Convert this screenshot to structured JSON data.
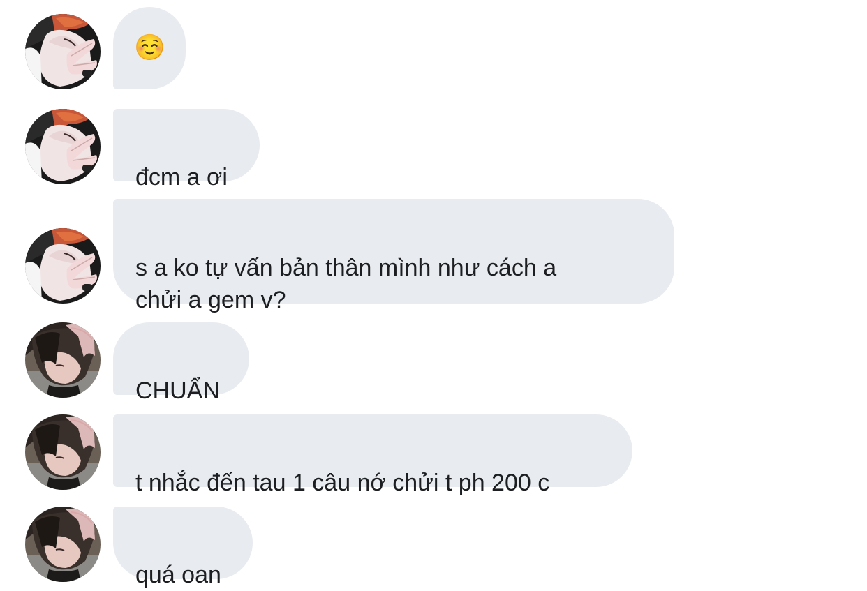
{
  "conversation": {
    "messages": [
      {
        "sender": "user-a",
        "text": "☺️"
      },
      {
        "sender": "user-a",
        "text": "đcm a ơi"
      },
      {
        "sender": "user-a",
        "text": "s a ko tự vấn bản thân mình như cách a\nchửi a gem v?"
      },
      {
        "sender": "user-b",
        "text": "CHUẨN"
      },
      {
        "sender": "user-b",
        "text": "t nhắc đến tau 1 câu nớ chửi t ph 200 c"
      },
      {
        "sender": "user-b",
        "text": "quá oan"
      }
    ]
  },
  "colors": {
    "bubble_bg": "#e8ebef",
    "text": "#1c1e21",
    "background": "#ffffff"
  }
}
